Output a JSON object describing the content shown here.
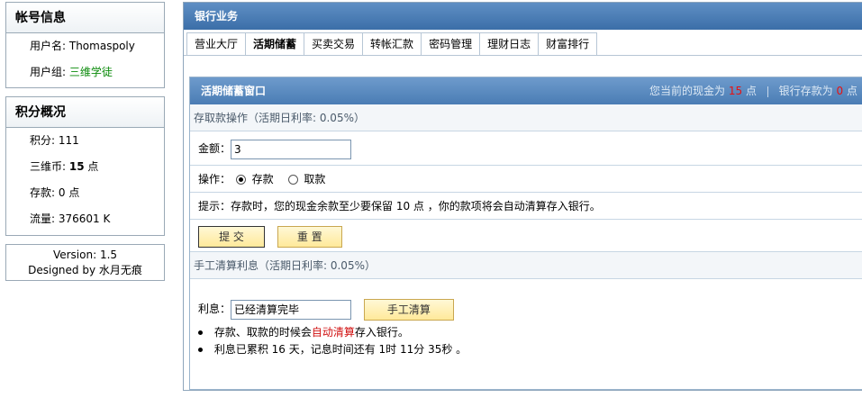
{
  "account": {
    "title": "帐号信息",
    "username_label": "用户名:",
    "username": "Thomaspoly",
    "group_label": "用户组:",
    "group": "三维学徒"
  },
  "points": {
    "title": "积分概况",
    "score_label": "积分:",
    "score": "111",
    "coins_label": "三维币:",
    "coins": "15",
    "coins_unit": "点",
    "deposit_label": "存款:",
    "deposit": "0 点",
    "traffic_label": "流量:",
    "traffic": "376601 K"
  },
  "version": {
    "line1": "Version: 1.5",
    "line2": "Designed by 水月无痕"
  },
  "main": {
    "title": "银行业务",
    "tabs": [
      {
        "label": "营业大厅"
      },
      {
        "label": "活期储蓄"
      },
      {
        "label": "买卖交易"
      },
      {
        "label": "转帐汇款"
      },
      {
        "label": "密码管理"
      },
      {
        "label": "理财日志"
      },
      {
        "label": "财富排行"
      }
    ]
  },
  "window": {
    "title": "活期储蓄窗口",
    "cash_prefix": "您当前的现金为",
    "cash": "15",
    "cash_unit": "点",
    "bank_prefix": "银行存款为",
    "bank": "0",
    "bank_unit": "点"
  },
  "deposit_form": {
    "section_title": "存取款操作（活期日利率: 0.05%）",
    "amount_label": "金额：",
    "amount_value": "3",
    "op_label": "操作：",
    "op_deposit": "存款",
    "op_withdraw": "取款",
    "hint": "提示：存款时，您的现金余款至少要保留  10 点 ，你的款项将会自动清算存入银行。",
    "submit": "提 交",
    "reset": "重 置"
  },
  "interest_form": {
    "section_title": "手工清算利息（活期日利率: 0.05%）",
    "interest_label": "利息：",
    "interest_value": "已经清算完毕",
    "settle_button": "手工清算",
    "note1_prefix": "存款、取款的时候会",
    "note1_link": "自动清算",
    "note1_suffix": "存入银行。",
    "note2": "利息已累积  16 天，记息时间还有  1时  11分  35秒  。"
  },
  "colors": {
    "header_blue": "#3b6ea8",
    "accent_red": "#e81010",
    "group_green": "#0a8a0a",
    "button_yellow": "#ffe99a"
  }
}
